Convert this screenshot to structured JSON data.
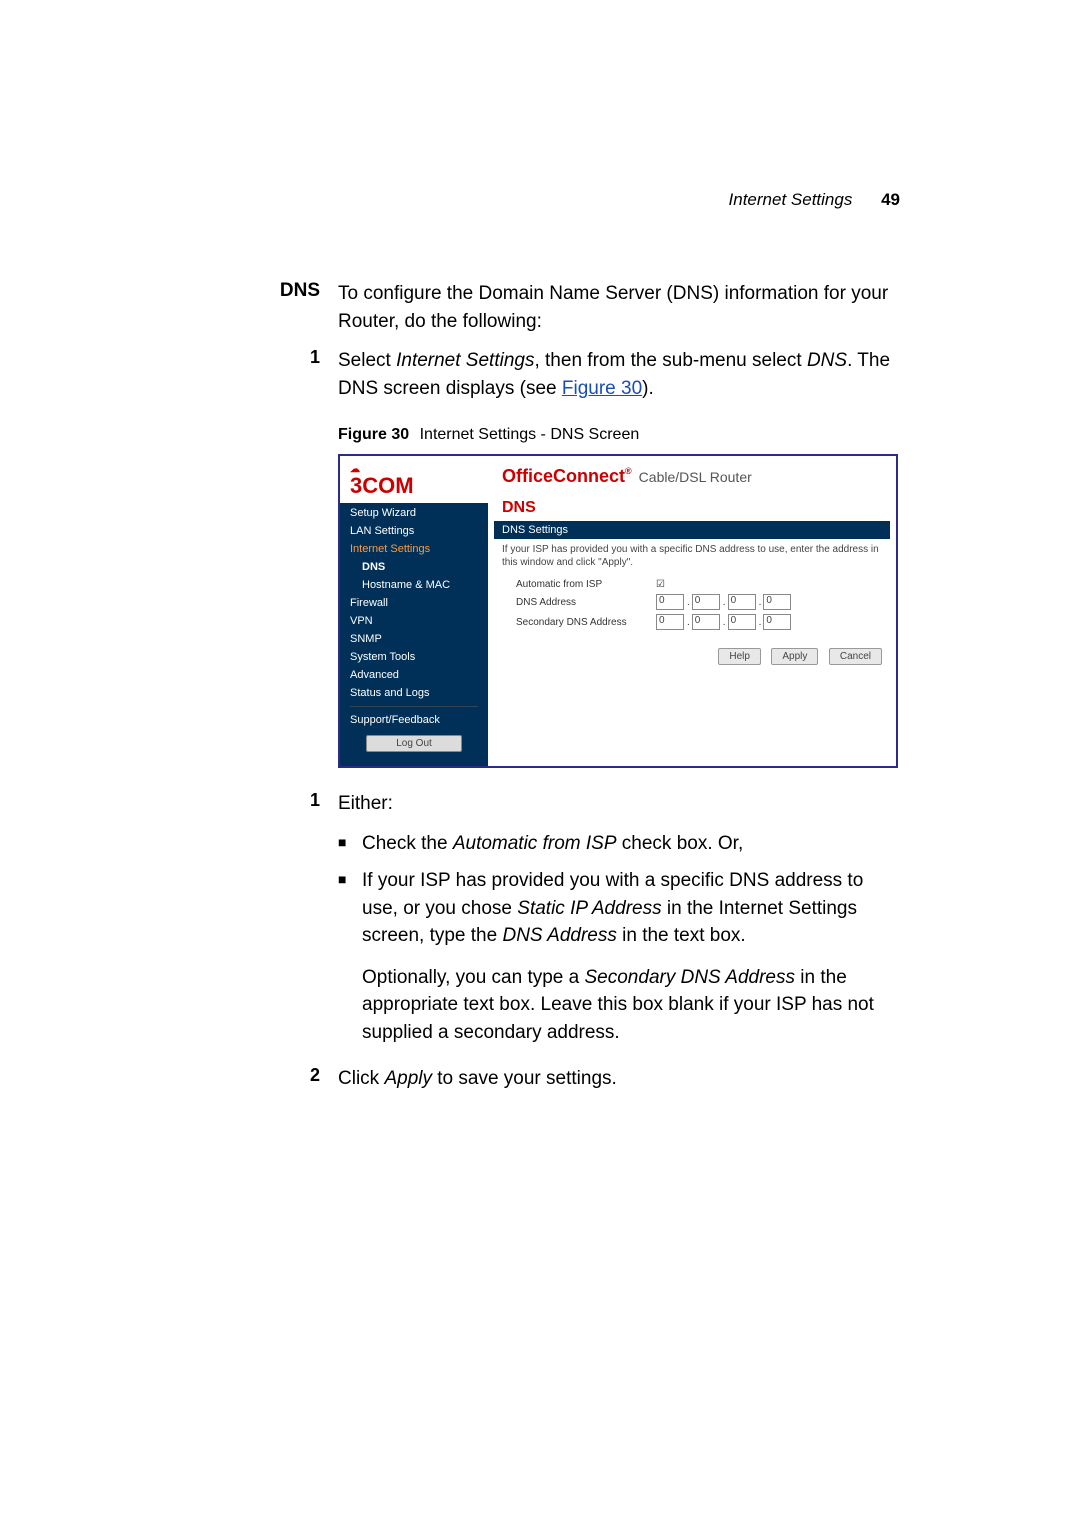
{
  "header": {
    "title": "Internet Settings",
    "page": "49"
  },
  "section_label": "DNS",
  "intro": "To configure the Domain Name Server (DNS) information for your Router, do the following:",
  "step1": {
    "num": "1",
    "pre": "Select ",
    "em1": "Internet Settings",
    "mid": ", then from the sub-menu select ",
    "em2": "DNS",
    "post": ". The DNS screen displays (see ",
    "link": "Figure 30",
    "tail": ")."
  },
  "figure": {
    "label": "Figure 30",
    "caption": "Internet Settings - DNS Screen"
  },
  "shot": {
    "logo": "3COM",
    "brand": "OfficeConnect",
    "brand_tm": "®",
    "brand_sub": "Cable/DSL Router",
    "nav": {
      "setup": "Setup Wizard",
      "lan": "LAN Settings",
      "inet": "Internet Settings",
      "dns": "DNS",
      "host": "Hostname & MAC",
      "fw": "Firewall",
      "vpn": "VPN",
      "snmp": "SNMP",
      "sys": "System Tools",
      "adv": "Advanced",
      "logs": "Status and Logs",
      "support": "Support/Feedback",
      "logout": "Log Out"
    },
    "h2": "DNS",
    "bar": "DNS Settings",
    "desc": "If your ISP has provided you with a specific DNS address to use, enter the address in this window and click \"Apply\".",
    "fields": {
      "auto": "Automatic from ISP",
      "dns": "DNS Address",
      "sdns": "Secondary DNS Address"
    },
    "oct": "0",
    "btns": {
      "help": "Help",
      "apply": "Apply",
      "cancel": "Cancel"
    }
  },
  "either": {
    "num": "1",
    "text": "Either:"
  },
  "b1": {
    "pre": "Check the ",
    "em": "Automatic from ISP",
    "post": " check box. Or,"
  },
  "b2": {
    "pre": "If your ISP has provided you with a specific DNS address to use, or you chose ",
    "em1": "Static IP Address",
    "mid": " in the Internet Settings screen, type the ",
    "em2": "DNS Address",
    "post": " in the text box."
  },
  "b2p": {
    "pre": "Optionally, you can type a ",
    "em": "Secondary DNS Address",
    "post": " in the appropriate text box. Leave this box blank if your ISP has not supplied a secondary address."
  },
  "step2": {
    "num": "2",
    "pre": "Click ",
    "em": "Apply",
    "post": " to save your settings."
  }
}
